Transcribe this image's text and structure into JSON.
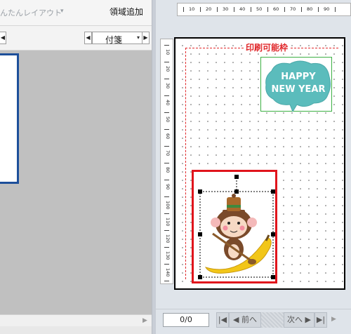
{
  "left_pane": {
    "layout_menu_label": "んたんレイアウト",
    "layout_menu_caret": "▾",
    "add_region_label": "領域追加",
    "sticky_select": {
      "value": "付箋",
      "prev_arrow": "◀",
      "next_arrow": "▶",
      "caret": "▾"
    },
    "left_arrow": "◀",
    "scroll_right_arrow": "▶"
  },
  "preview": {
    "printable_area_label": "印刷可能枠",
    "ruler_horizontal_labels": [
      "10",
      "20",
      "30",
      "40",
      "50",
      "60",
      "70",
      "80",
      "90"
    ],
    "ruler_vertical_labels": [
      "10",
      "20",
      "30",
      "40",
      "50",
      "60",
      "70",
      "80",
      "90",
      "100",
      "110",
      "120",
      "130",
      "140"
    ],
    "card_text_line1": "HAPPY",
    "card_text_line2": "NEW YEAR",
    "colors": {
      "printable_frame": "#e0272a",
      "selection_frame": "#e0141c",
      "card_box_border": "#3cb043",
      "card_bubble": "#5bbcbc"
    }
  },
  "navigation": {
    "page_counter": "0/0",
    "first_icon": "|◀",
    "prev_label": "◀ 前へ",
    "next_label": "次へ ▶",
    "last_icon": "▶|",
    "scroll_arrow": "▶"
  }
}
